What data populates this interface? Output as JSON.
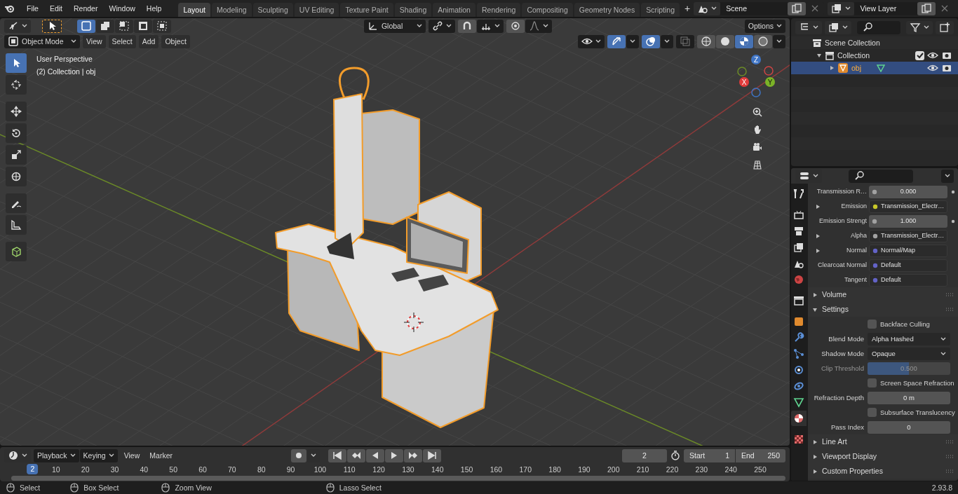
{
  "top_bar": {
    "menus": [
      "File",
      "Edit",
      "Render",
      "Window",
      "Help"
    ],
    "workspaces": [
      {
        "label": "Layout",
        "selected": true
      },
      {
        "label": "Modeling",
        "selected": false
      },
      {
        "label": "Sculpting",
        "selected": false
      },
      {
        "label": "UV Editing",
        "selected": false
      },
      {
        "label": "Texture Paint",
        "selected": false
      },
      {
        "label": "Shading",
        "selected": false
      },
      {
        "label": "Animation",
        "selected": false
      },
      {
        "label": "Rendering",
        "selected": false
      },
      {
        "label": "Compositing",
        "selected": false
      },
      {
        "label": "Geometry Nodes",
        "selected": false
      },
      {
        "label": "Scripting",
        "selected": false
      }
    ],
    "add_workspace": "+",
    "scene": "Scene",
    "view_layer": "View Layer"
  },
  "viewport": {
    "select_modes": [
      {
        "selected": true
      },
      {
        "selected": false
      },
      {
        "selected": false
      },
      {
        "selected": false
      },
      {
        "selected": false
      }
    ],
    "orientation": "Global",
    "options": "Options",
    "mode": "Object Mode",
    "menus": [
      "View",
      "Select",
      "Add",
      "Object"
    ],
    "shading_modes": [
      {
        "selected": false
      },
      {
        "selected": false
      },
      {
        "selected": true
      },
      {
        "selected": false
      }
    ],
    "tools": [
      {
        "selected": true
      },
      {
        "selected": false
      },
      {
        "selected": false
      },
      {
        "selected": false
      },
      {
        "selected": false
      },
      {
        "selected": false
      },
      {
        "selected": false
      },
      {
        "selected": false
      },
      {
        "selected": false
      }
    ],
    "view_name": "User Perspective",
    "object_info": "(2) Collection | obj",
    "gizmo_axes": [
      "X",
      "Y",
      "Z"
    ]
  },
  "outliner": {
    "tree": [
      {
        "label": "Scene Collection",
        "children": [
          {
            "label": "Collection",
            "expanded": true,
            "checked": true,
            "children": [
              {
                "label": "obj",
                "expanded": false,
                "selected": true
              }
            ]
          }
        ]
      }
    ]
  },
  "properties": {
    "tabs": [
      {
        "selected": false
      },
      {
        "selected": false
      },
      {
        "selected": false
      },
      {
        "selected": false
      },
      {
        "selected": false
      },
      {
        "selected": false
      },
      {
        "selected": false
      },
      {
        "selected": false
      },
      {
        "selected": false
      },
      {
        "selected": false
      },
      {
        "selected": false
      },
      {
        "selected": false
      },
      {
        "selected": false
      },
      {
        "selected": true
      },
      {
        "selected": false
      }
    ],
    "rows": [
      {
        "kind": "number",
        "label": "Transmission R…",
        "value": "0.000",
        "color": "#a1a1a1",
        "decorator": true
      },
      {
        "kind": "socket",
        "label": "Emission",
        "expandable": true,
        "value": "Transmission_Electr…",
        "color": "#c7c729"
      },
      {
        "kind": "number",
        "label": "Emission Strengt",
        "value": "1.000",
        "color": "#a1a1a1",
        "decorator": true
      },
      {
        "kind": "socket",
        "label": "Alpha",
        "expandable": true,
        "value": "Transmission_Electr…",
        "color": "#a1a1a1"
      },
      {
        "kind": "socket",
        "label": "Normal",
        "expandable": true,
        "value": "Normal/Map",
        "color": "#6363c7"
      },
      {
        "kind": "socket",
        "label": "Clearcoat Normal",
        "expandable": false,
        "value": "Default",
        "color": "#6363c7"
      },
      {
        "kind": "socket",
        "label": "Tangent",
        "expandable": false,
        "value": "Default",
        "color": "#6363c7"
      },
      {
        "kind": "panel",
        "label": "Volume",
        "expanded": false
      },
      {
        "kind": "panel",
        "label": "Settings",
        "expanded": true
      },
      {
        "kind": "checkbox",
        "label": "Backface Culling",
        "checked": false
      },
      {
        "kind": "dropdown",
        "label": "Blend Mode",
        "value": "Alpha Hashed"
      },
      {
        "kind": "dropdown",
        "label": "Shadow Mode",
        "value": "Opaque"
      },
      {
        "kind": "slider",
        "label": "Clip Threshold",
        "value": "0.500",
        "level": 0.5,
        "disabled": true
      },
      {
        "kind": "checkbox",
        "label": "Screen Space Refraction",
        "checked": false
      },
      {
        "kind": "field",
        "label": "Refraction Depth",
        "value": "0 m"
      },
      {
        "kind": "checkbox",
        "label": "Subsurface Translucency",
        "checked": false
      },
      {
        "kind": "field",
        "label": "Pass Index",
        "value": "0"
      },
      {
        "kind": "panel",
        "label": "Line Art",
        "expanded": false
      },
      {
        "kind": "panel",
        "label": "Viewport Display",
        "expanded": false
      },
      {
        "kind": "panel",
        "label": "Custom Properties",
        "expanded": false
      }
    ]
  },
  "timeline": {
    "menus": [
      "Playback",
      "Keying",
      "View",
      "Marker"
    ],
    "current_frame": "2",
    "start_label": "Start",
    "start": "1",
    "end_label": "End",
    "end": "250",
    "ruler": [
      "10",
      "20",
      "30",
      "40",
      "50",
      "60",
      "70",
      "80",
      "90",
      "100",
      "110",
      "120",
      "130",
      "140",
      "150",
      "160",
      "170",
      "180",
      "190",
      "200",
      "210",
      "220",
      "230",
      "240",
      "250"
    ],
    "marker": "2"
  },
  "status_bar": {
    "hints": [
      "Select",
      "Box Select",
      "Zoom View",
      "Lasso Select"
    ],
    "version": "2.93.8"
  }
}
